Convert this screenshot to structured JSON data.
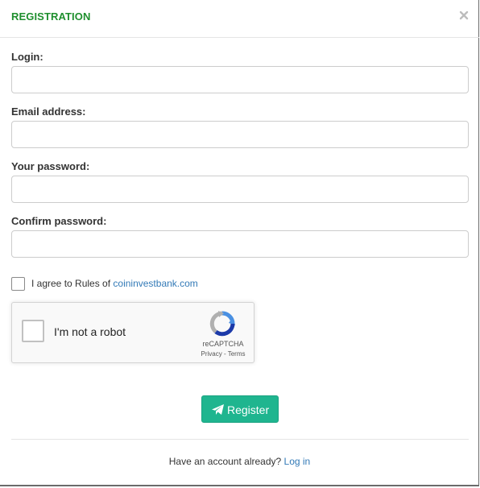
{
  "header": {
    "title": "REGISTRATION",
    "close_icon": "close-icon"
  },
  "form": {
    "fields": [
      {
        "label": "Login:",
        "value": "",
        "placeholder": ""
      },
      {
        "label": "Email address:",
        "value": "",
        "placeholder": ""
      },
      {
        "label": "Your password:",
        "value": "",
        "placeholder": ""
      },
      {
        "label": "Confirm password:",
        "value": "",
        "placeholder": ""
      }
    ],
    "agree": {
      "checked": false,
      "text": "I agree to Rules of",
      "link_text": "coininvestbank.com"
    }
  },
  "captcha": {
    "checkbox_label": "I'm not a robot",
    "brand": "reCAPTCHA",
    "privacy": "Privacy",
    "separator": " - ",
    "terms": "Terms",
    "logo_icon": "recaptcha-logo-icon"
  },
  "actions": {
    "register_label": "Register",
    "register_icon": "paper-plane-icon",
    "accent_color": "#1fb58f"
  },
  "footer": {
    "prompt": "Have an account already?",
    "login_link": "Log in"
  },
  "colors": {
    "title": "#1f8f2e",
    "link": "#337ab7"
  }
}
